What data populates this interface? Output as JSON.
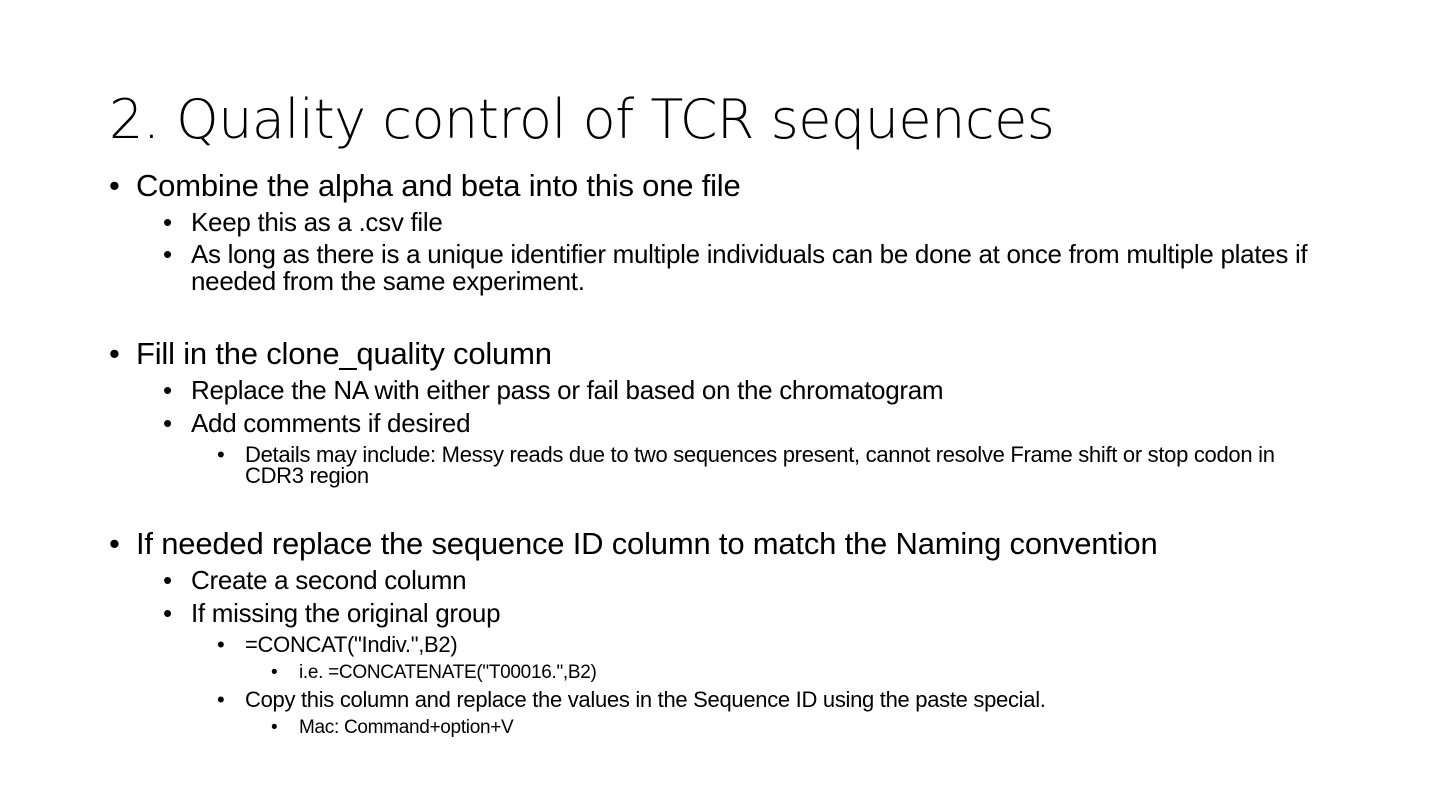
{
  "slide": {
    "title": "2. Quality control of TCR sequences",
    "bullet_glyph": "•",
    "sections": [
      {
        "text": "Combine the alpha and beta into this one file",
        "items": [
          {
            "text": "Keep this as a .csv file"
          },
          {
            "text": "As long as there is a unique identifier multiple individuals can be done at once from multiple plates if needed from the same experiment."
          }
        ]
      },
      {
        "text": "Fill in the clone_quality column",
        "items": [
          {
            "text": "Replace the NA with either pass or fail based on the chromatogram"
          },
          {
            "text": "Add comments if desired",
            "items": [
              {
                "text": "Details may include: Messy reads due to two sequences present, cannot resolve Frame shift or stop codon in CDR3 region"
              }
            ]
          }
        ]
      },
      {
        "text": "If needed replace the sequence ID column to match the Naming convention",
        "items": [
          {
            "text": "Create a second column"
          },
          {
            "text": "If missing the original group",
            "items": [
              {
                "text": "=CONCAT(\"Indiv.\",B2)",
                "items": [
                  {
                    "text": "i.e. =CONCATENATE(\"T00016.\",B2)"
                  }
                ]
              },
              {
                "text": "Copy this column and replace the values in the Sequence ID using the paste special.",
                "items": [
                  {
                    "text": "Mac: Command+option+V"
                  }
                ]
              }
            ]
          }
        ]
      }
    ]
  }
}
